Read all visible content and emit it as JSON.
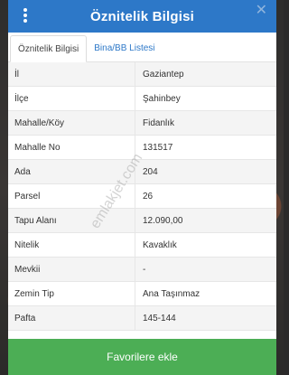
{
  "dialog": {
    "title": "Öznitelik Bilgisi",
    "close_glyph": "✕"
  },
  "tabs": [
    {
      "label": "Öznitelik Bilgisi",
      "active": true
    },
    {
      "label": "Bina/BB Listesi",
      "active": false
    }
  ],
  "attributes": [
    {
      "label": "İl",
      "value": "Gaziantep"
    },
    {
      "label": "İlçe",
      "value": "Şahinbey"
    },
    {
      "label": "Mahalle/Köy",
      "value": "Fidanlık"
    },
    {
      "label": "Mahalle No",
      "value": "131517"
    },
    {
      "label": "Ada",
      "value": "204"
    },
    {
      "label": "Parsel",
      "value": "26"
    },
    {
      "label": "Tapu Alanı",
      "value": "12.090,00"
    },
    {
      "label": "Nitelik",
      "value": "Kavaklık"
    },
    {
      "label": "Mevkii",
      "value": "-"
    },
    {
      "label": "Zemin Tip",
      "value": "Ana Taşınmaz"
    },
    {
      "label": "Pafta",
      "value": "145-144"
    }
  ],
  "watermark": "emlakjet.com",
  "footer": {
    "favorite_label": "Favorilere ekle"
  },
  "colors": {
    "header": "#2d78c8",
    "tab_link": "#2d78c8",
    "favorite_button": "#4cae55"
  }
}
